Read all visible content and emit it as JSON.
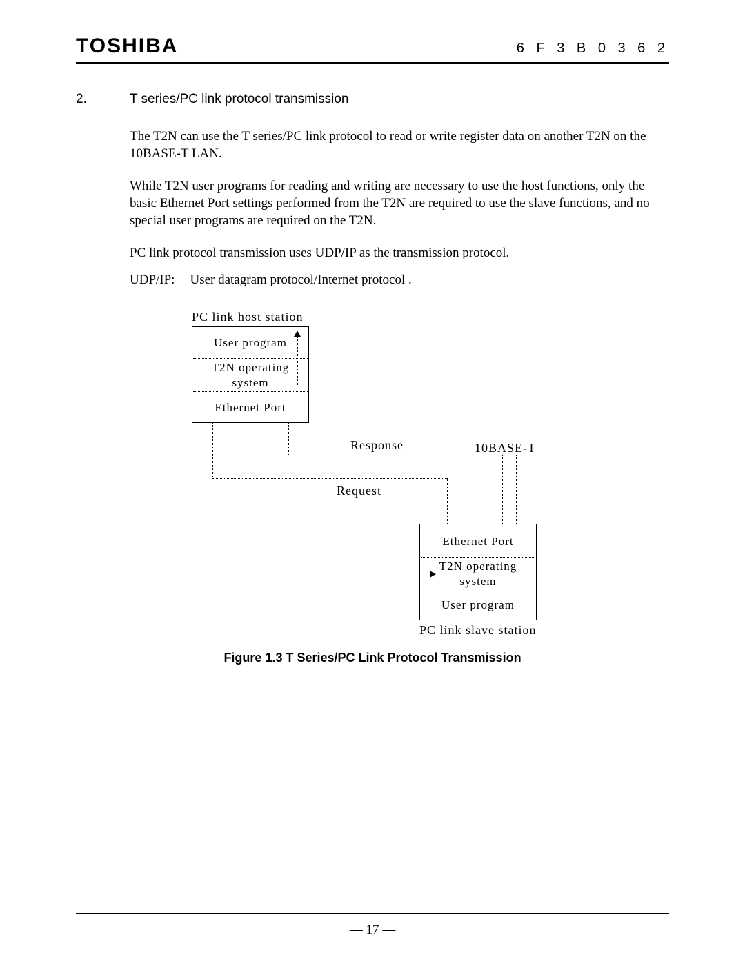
{
  "header": {
    "brand": "TOSHIBA",
    "doc_code": "6 F 3 B 0 3 6 2"
  },
  "section": {
    "number": "2.",
    "title": "T series/PC link protocol transmission"
  },
  "paragraphs": {
    "p1": "The T2N can use the T series/PC link protocol to read or write register data on another T2N on the 10BASE-T LAN.",
    "p2": "While T2N user programs for reading and writing are necessary to use the host functions, only the basic Ethernet Port settings performed from the T2N are required to use the slave functions, and no special user programs are required on the T2N.",
    "p3": "PC link protocol transmission uses UDP/IP as the transmission protocol.",
    "udp_label": "UDP/IP:",
    "udp_def": "User datagram protocol/Internet protocol ."
  },
  "diagram": {
    "host_label": "PC link host station",
    "slave_label": "PC link slave station",
    "user_program": "User program",
    "t2n_os": "T2N operating system",
    "ethernet_port": "Ethernet Port",
    "response": "Response",
    "request": "Request",
    "bus": "10BASE-T"
  },
  "figure_caption": "Figure 1.3    T Series/PC Link Protocol Transmission",
  "footer": {
    "page": "— 17 —"
  }
}
